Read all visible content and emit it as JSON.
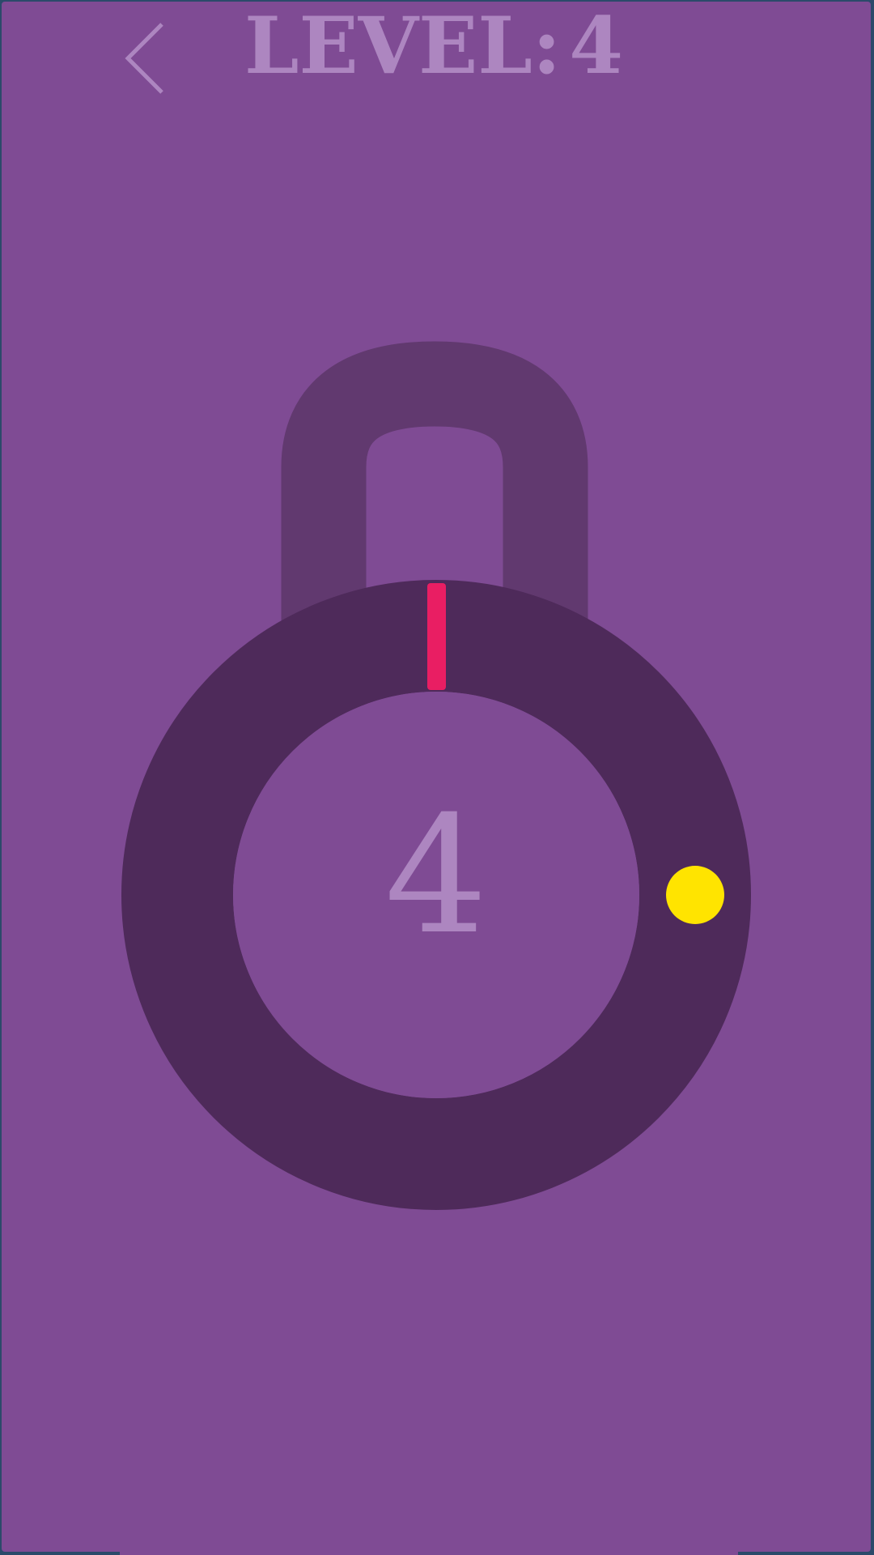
{
  "header": {
    "title_label": "LEVEL:",
    "level_value": "4"
  },
  "game": {
    "remaining_count": "4",
    "lock_color": "#4e2a5a",
    "shackle_color": "#61396f",
    "background_color": "#7f4b94",
    "needle_color": "#e91e63",
    "target_color": "#ffe400",
    "text_color": "#ad86c0"
  },
  "icons": {
    "back": "chevron-left-icon"
  }
}
